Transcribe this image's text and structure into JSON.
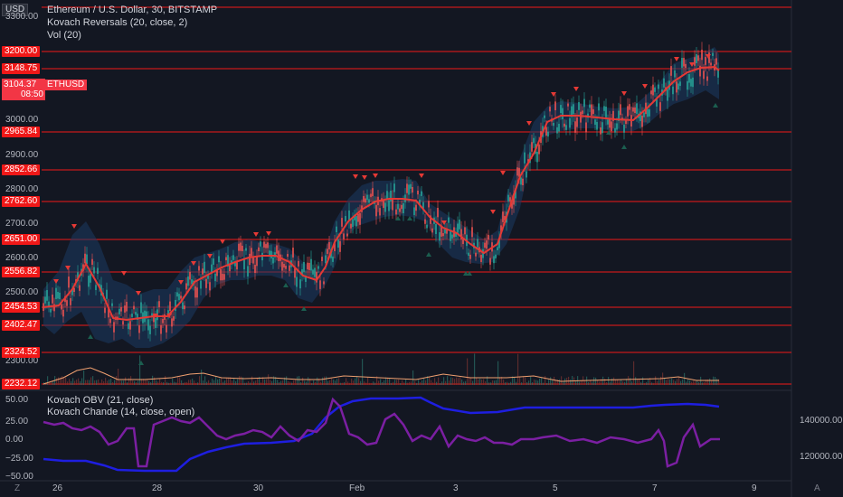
{
  "header": {
    "currency_button": "USD",
    "symbol_title": "Ethereum / U.S. Dollar, 30, BITSTAMP",
    "indicator_1": "Kovach Reversals (20, close, 2)",
    "indicator_2": "Vol (20)"
  },
  "price_badge": {
    "price": "3104.37",
    "countdown": "08:50",
    "symbol": "ETHUSD"
  },
  "price_axis_ticks": [
    "3300.00",
    "3000.00",
    "2900.00",
    "2800.00",
    "2700.00",
    "2600.00",
    "2500.00",
    "2300.00"
  ],
  "level_tags": [
    "3200.00",
    "3148.75",
    "2965.84",
    "2852.66",
    "2762.60",
    "2651.00",
    "2556.82",
    "2454.53",
    "2402.47",
    "2324.52",
    "2232.12"
  ],
  "lower_pane": {
    "indicator_1": "Kovach OBV (21, close)",
    "indicator_2": "Kovach Chande (14, close, open)",
    "left_ticks": [
      "50.00",
      "25.00",
      "0.00",
      "−25.00",
      "−50.00"
    ],
    "right_ticks": [
      "140000.00",
      "120000.00"
    ]
  },
  "time_axis": [
    "26",
    "28",
    "30",
    "Feb",
    "3",
    "5",
    "7",
    "9"
  ],
  "buttons": {
    "z": "Z",
    "a": "A"
  },
  "colors": {
    "level_line": "#f01818",
    "price_line": "#e53935",
    "obv": "#1e1ee0",
    "chande": "#7b1fa2",
    "band": "#1c3a63"
  }
}
